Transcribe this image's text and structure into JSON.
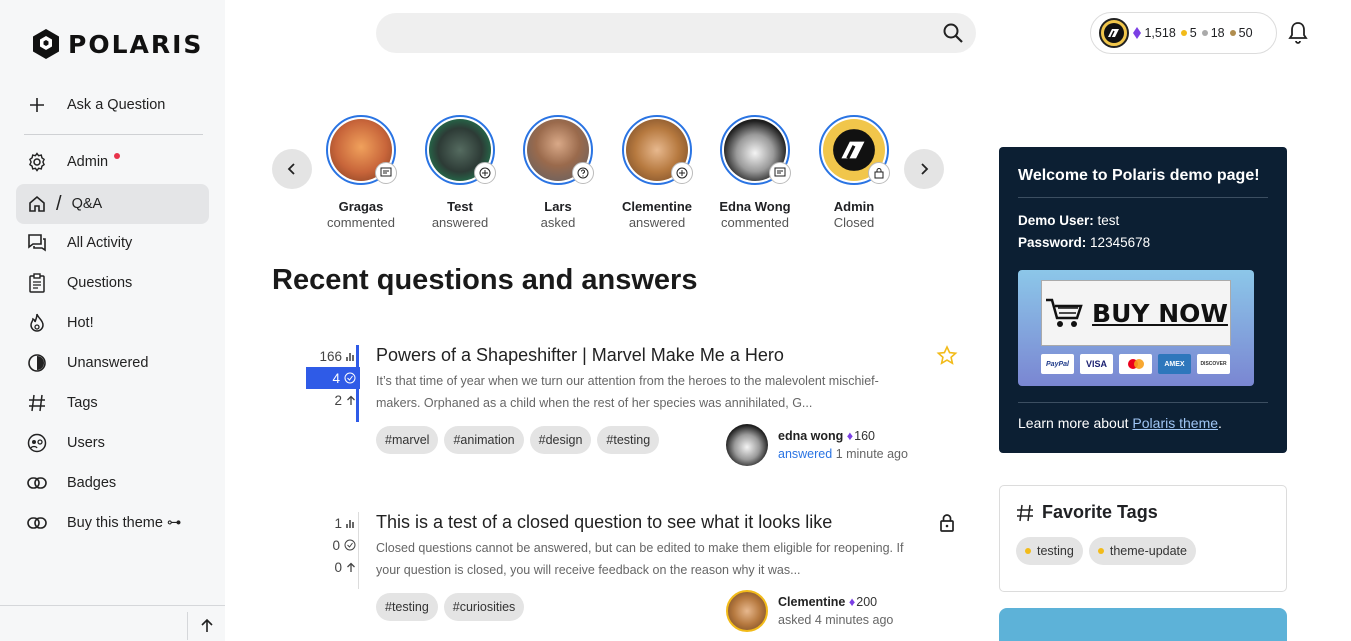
{
  "brand": {
    "name": "POLARIS"
  },
  "sidebar": {
    "items": [
      {
        "label": "Ask a Question",
        "icon": "plus-icon"
      },
      {
        "label": "Admin",
        "icon": "gear-icon",
        "dot": true
      },
      {
        "label": "Q&A",
        "icon": "home-icon",
        "active": true
      },
      {
        "label": "All Activity",
        "icon": "chat-icon"
      },
      {
        "label": "Questions",
        "icon": "clipboard-icon"
      },
      {
        "label": "Hot!",
        "icon": "fire-icon"
      },
      {
        "label": "Unanswered",
        "icon": "half-circle-icon"
      },
      {
        "label": "Tags",
        "icon": "hash-icon"
      },
      {
        "label": "Users",
        "icon": "users-icon"
      },
      {
        "label": "Badges",
        "icon": "link-icon"
      },
      {
        "label": "Buy this theme ⊶",
        "icon": "link-icon"
      }
    ],
    "qa_separator": "/"
  },
  "header": {
    "search_placeholder": "",
    "user": {
      "diamonds": "1,518",
      "gold": "5",
      "silver": "18",
      "bronze": "50"
    }
  },
  "stories": [
    {
      "name": "Gragas",
      "action": "commented",
      "badge": "comment-icon"
    },
    {
      "name": "Test",
      "action": "answered",
      "badge": "plus-chat-icon"
    },
    {
      "name": "Lars",
      "action": "asked",
      "badge": "question-icon"
    },
    {
      "name": "Clementine",
      "action": "answered",
      "badge": "plus-chat-icon"
    },
    {
      "name": "Edna Wong",
      "action": "commented",
      "badge": "comment-icon"
    },
    {
      "name": "Admin",
      "action": "Closed",
      "badge": "lock-icon"
    }
  ],
  "main": {
    "title": "Recent questions and answers"
  },
  "questions": [
    {
      "views": "166",
      "answers": "4",
      "votes": "2",
      "title": "Powers of a Shapeshifter | Marvel Make Me a Hero",
      "excerpt": "It’s that time of year when we turn our attention from the heroes to the malevolent mischief-makers. Orphaned as a child when the rest of her species was annihilated, G...",
      "tags": [
        "#marvel",
        "#animation",
        "#design",
        "#testing"
      ],
      "author": "edna wong",
      "points": "160",
      "action": "answered",
      "when": "1 minute ago"
    },
    {
      "views": "1",
      "answers": "0",
      "votes": "0",
      "title": "This is a test of a closed question to see what it looks like",
      "excerpt": "Closed questions cannot be answered, but can be edited to make them eligible for reopening. If your question is closed, you will receive feedback on the reason why it was...",
      "tags": [
        "#testing",
        "#curiosities"
      ],
      "author": "Clementine",
      "points": "200",
      "action": "asked",
      "when": "4 minutes ago"
    }
  ],
  "welcome": {
    "title": "Welcome to Polaris demo page!",
    "user_label": "Demo User:",
    "user_value": "test",
    "pass_label": "Password:",
    "pass_value": "12345678",
    "buy_label": "BUY NOW",
    "cards": [
      "PayPal",
      "VISA",
      "MC",
      "AMEX",
      "DISCOVER"
    ],
    "more_prefix": "Learn more about",
    "more_link": "Polaris theme",
    "more_suffix": "."
  },
  "favorite_tags": {
    "title": "Favorite Tags",
    "tags": [
      "testing",
      "theme-update"
    ]
  },
  "colors": {
    "accent": "#2f5be7",
    "story_ring": "#2a74e3",
    "panel_dark": "#0c1f33",
    "diamond": "#7b3fe4"
  }
}
